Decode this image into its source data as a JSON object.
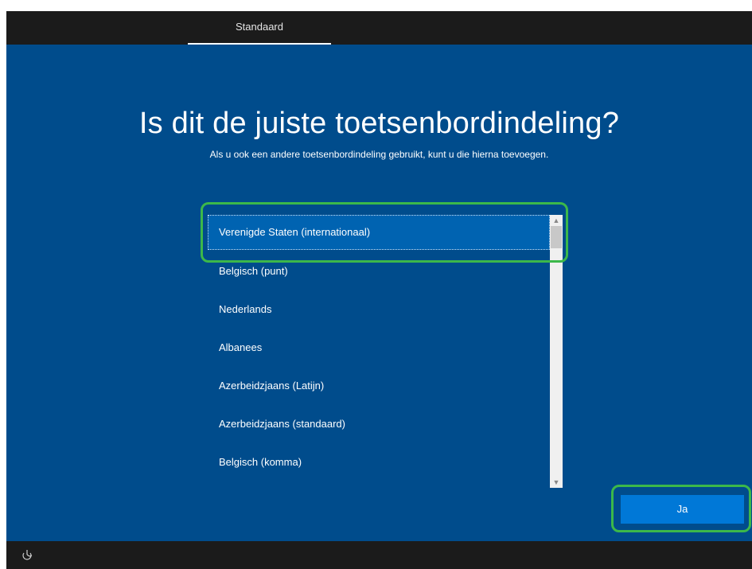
{
  "header": {
    "tab_label": "Standaard"
  },
  "main": {
    "title": "Is dit de juiste toetsenbordindeling?",
    "subtitle": "Als u ook een andere toetsenbordindeling gebruikt, kunt u die hierna toevoegen."
  },
  "layout_list": {
    "selected_index": 0,
    "items": [
      "Verenigde Staten (internationaal)",
      "Belgisch (punt)",
      "Nederlands",
      "Albanees",
      "Azerbeidzjaans (Latijn)",
      "Azerbeidzjaans (standaard)",
      "Belgisch (komma)"
    ]
  },
  "footer": {
    "confirm_label": "Ja"
  },
  "icons": {
    "accessibility": "accessibility-icon",
    "scroll_up": "chevron-up-icon",
    "scroll_down": "chevron-down-icon"
  },
  "colors": {
    "background": "#004c8c",
    "selected_item": "#0063b1",
    "button": "#0078d7",
    "bars": "#1b1b1b",
    "highlight": "#3cb84a"
  }
}
